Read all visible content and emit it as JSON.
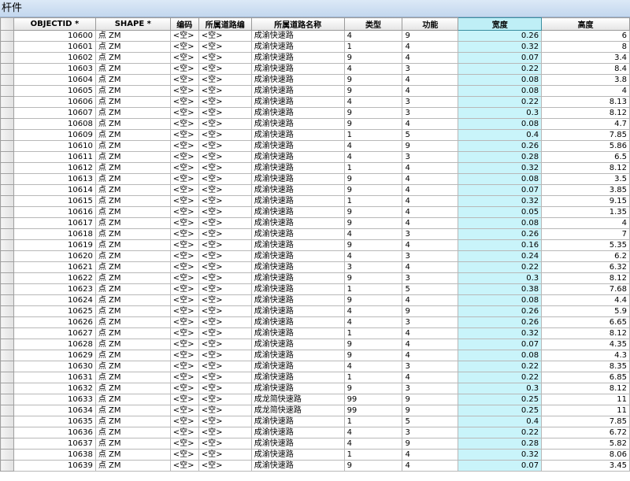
{
  "window": {
    "title": "杆件"
  },
  "table": {
    "columns": [
      "OBJECTID *",
      "SHAPE *",
      "编码",
      "所属道路编",
      "所属道路名称",
      "类型",
      "功能",
      "宽度",
      "高度"
    ],
    "selected_column": "宽度",
    "rows": [
      [
        "10600",
        "点 ZM",
        "<空>",
        "<空>",
        "成渝快速路",
        "4",
        "9",
        "0.26",
        "6"
      ],
      [
        "10601",
        "点 ZM",
        "<空>",
        "<空>",
        "成渝快速路",
        "1",
        "4",
        "0.32",
        "8"
      ],
      [
        "10602",
        "点 ZM",
        "<空>",
        "<空>",
        "成渝快速路",
        "9",
        "4",
        "0.07",
        "3.4"
      ],
      [
        "10603",
        "点 ZM",
        "<空>",
        "<空>",
        "成渝快速路",
        "4",
        "3",
        "0.22",
        "8.4"
      ],
      [
        "10604",
        "点 ZM",
        "<空>",
        "<空>",
        "成渝快速路",
        "9",
        "4",
        "0.08",
        "3.8"
      ],
      [
        "10605",
        "点 ZM",
        "<空>",
        "<空>",
        "成渝快速路",
        "9",
        "4",
        "0.08",
        "4"
      ],
      [
        "10606",
        "点 ZM",
        "<空>",
        "<空>",
        "成渝快速路",
        "4",
        "3",
        "0.22",
        "8.13"
      ],
      [
        "10607",
        "点 ZM",
        "<空>",
        "<空>",
        "成渝快速路",
        "9",
        "3",
        "0.3",
        "8.12"
      ],
      [
        "10608",
        "点 ZM",
        "<空>",
        "<空>",
        "成渝快速路",
        "9",
        "4",
        "0.08",
        "4.7"
      ],
      [
        "10609",
        "点 ZM",
        "<空>",
        "<空>",
        "成渝快速路",
        "1",
        "5",
        "0.4",
        "7.85"
      ],
      [
        "10610",
        "点 ZM",
        "<空>",
        "<空>",
        "成渝快速路",
        "4",
        "9",
        "0.26",
        "5.86"
      ],
      [
        "10611",
        "点 ZM",
        "<空>",
        "<空>",
        "成渝快速路",
        "4",
        "3",
        "0.28",
        "6.5"
      ],
      [
        "10612",
        "点 ZM",
        "<空>",
        "<空>",
        "成渝快速路",
        "1",
        "4",
        "0.32",
        "8.12"
      ],
      [
        "10613",
        "点 ZM",
        "<空>",
        "<空>",
        "成渝快速路",
        "9",
        "4",
        "0.08",
        "3.5"
      ],
      [
        "10614",
        "点 ZM",
        "<空>",
        "<空>",
        "成渝快速路",
        "9",
        "4",
        "0.07",
        "3.85"
      ],
      [
        "10615",
        "点 ZM",
        "<空>",
        "<空>",
        "成渝快速路",
        "1",
        "4",
        "0.32",
        "9.15"
      ],
      [
        "10616",
        "点 ZM",
        "<空>",
        "<空>",
        "成渝快速路",
        "9",
        "4",
        "0.05",
        "1.35"
      ],
      [
        "10617",
        "点 ZM",
        "<空>",
        "<空>",
        "成渝快速路",
        "9",
        "4",
        "0.08",
        "4"
      ],
      [
        "10618",
        "点 ZM",
        "<空>",
        "<空>",
        "成渝快速路",
        "4",
        "3",
        "0.26",
        "7"
      ],
      [
        "10619",
        "点 ZM",
        "<空>",
        "<空>",
        "成渝快速路",
        "9",
        "4",
        "0.16",
        "5.35"
      ],
      [
        "10620",
        "点 ZM",
        "<空>",
        "<空>",
        "成渝快速路",
        "4",
        "3",
        "0.24",
        "6.2"
      ],
      [
        "10621",
        "点 ZM",
        "<空>",
        "<空>",
        "成渝快速路",
        "3",
        "4",
        "0.22",
        "6.32"
      ],
      [
        "10622",
        "点 ZM",
        "<空>",
        "<空>",
        "成渝快速路",
        "9",
        "3",
        "0.3",
        "8.12"
      ],
      [
        "10623",
        "点 ZM",
        "<空>",
        "<空>",
        "成渝快速路",
        "1",
        "5",
        "0.38",
        "7.68"
      ],
      [
        "10624",
        "点 ZM",
        "<空>",
        "<空>",
        "成渝快速路",
        "9",
        "4",
        "0.08",
        "4.4"
      ],
      [
        "10625",
        "点 ZM",
        "<空>",
        "<空>",
        "成渝快速路",
        "4",
        "9",
        "0.26",
        "5.9"
      ],
      [
        "10626",
        "点 ZM",
        "<空>",
        "<空>",
        "成渝快速路",
        "4",
        "3",
        "0.26",
        "6.65"
      ],
      [
        "10627",
        "点 ZM",
        "<空>",
        "<空>",
        "成渝快速路",
        "1",
        "4",
        "0.32",
        "8.12"
      ],
      [
        "10628",
        "点 ZM",
        "<空>",
        "<空>",
        "成渝快速路",
        "9",
        "4",
        "0.07",
        "4.35"
      ],
      [
        "10629",
        "点 ZM",
        "<空>",
        "<空>",
        "成渝快速路",
        "9",
        "4",
        "0.08",
        "4.3"
      ],
      [
        "10630",
        "点 ZM",
        "<空>",
        "<空>",
        "成渝快速路",
        "4",
        "3",
        "0.22",
        "8.35"
      ],
      [
        "10631",
        "点 ZM",
        "<空>",
        "<空>",
        "成渝快速路",
        "1",
        "4",
        "0.22",
        "6.85"
      ],
      [
        "10632",
        "点 ZM",
        "<空>",
        "<空>",
        "成渝快速路",
        "9",
        "3",
        "0.3",
        "8.12"
      ],
      [
        "10633",
        "点 ZM",
        "<空>",
        "<空>",
        "成龙简快速路",
        "99",
        "9",
        "0.25",
        "11"
      ],
      [
        "10634",
        "点 ZM",
        "<空>",
        "<空>",
        "成龙简快速路",
        "99",
        "9",
        "0.25",
        "11"
      ],
      [
        "10635",
        "点 ZM",
        "<空>",
        "<空>",
        "成渝快速路",
        "1",
        "5",
        "0.4",
        "7.85"
      ],
      [
        "10636",
        "点 ZM",
        "<空>",
        "<空>",
        "成渝快速路",
        "4",
        "3",
        "0.22",
        "6.72"
      ],
      [
        "10637",
        "点 ZM",
        "<空>",
        "<空>",
        "成渝快速路",
        "4",
        "9",
        "0.28",
        "5.82"
      ],
      [
        "10638",
        "点 ZM",
        "<空>",
        "<空>",
        "成渝快速路",
        "1",
        "4",
        "0.32",
        "8.06"
      ],
      [
        "10639",
        "点 ZM",
        "<空>",
        "<空>",
        "成渝快速路",
        "9",
        "4",
        "0.07",
        "3.45"
      ]
    ]
  }
}
